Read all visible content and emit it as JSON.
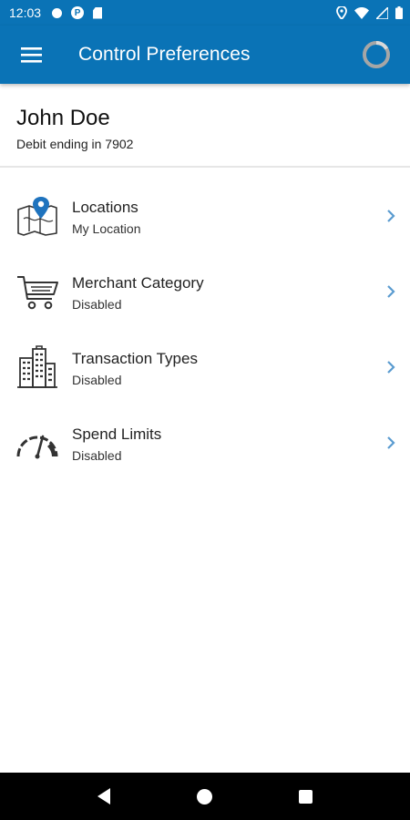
{
  "status_bar": {
    "time": "12:03",
    "icons": [
      "notification-dot-icon",
      "p-app-icon",
      "sd-card-icon",
      "location-icon",
      "wifi-icon",
      "signal-icon",
      "battery-icon"
    ],
    "p_glyph": "P"
  },
  "app_bar": {
    "title": "Control Preferences",
    "menu_icon": "hamburger-menu-icon",
    "loading_icon": "loading-spinner-icon"
  },
  "user": {
    "name": "John Doe",
    "card_text": "Debit ending in 7902"
  },
  "controls": [
    {
      "label": "Locations",
      "status": "My Location",
      "icon": "map-pin-icon"
    },
    {
      "label": "Merchant Category",
      "status": "Disabled",
      "icon": "shopping-cart-icon"
    },
    {
      "label": "Transaction Types",
      "status": "Disabled",
      "icon": "buildings-icon"
    },
    {
      "label": "Spend Limits",
      "status": "Disabled",
      "icon": "speedometer-icon"
    }
  ],
  "colors": {
    "primary": "#0a73b6",
    "accent": "#2f8fd0",
    "chevron": "#5a9bd0"
  },
  "nav_bar": {
    "buttons": [
      "back-icon",
      "home-icon",
      "recent-apps-icon"
    ]
  }
}
